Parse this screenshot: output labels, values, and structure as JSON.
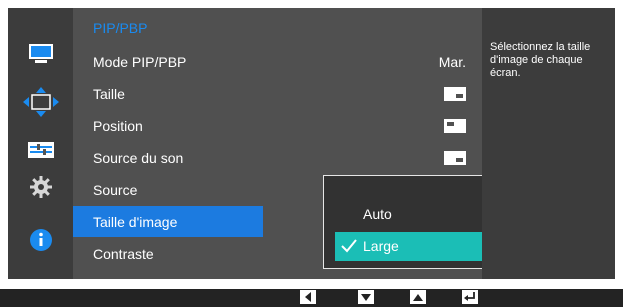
{
  "sidebar": {
    "icons": [
      "monitor-icon",
      "move-arrows-icon",
      "keyboard-settings-icon",
      "gear-icon",
      "info-icon"
    ]
  },
  "menu": {
    "title": "PIP/PBP",
    "items": [
      {
        "label": "Mode PIP/PBP",
        "value": "Mar."
      },
      {
        "label": "Taille",
        "value_icon": "pip-size-thumbnail"
      },
      {
        "label": "Position",
        "value_icon": "pip-position-thumbnail"
      },
      {
        "label": "Source du son",
        "value_icon": "sound-source-thumbnail"
      },
      {
        "label": "Source"
      },
      {
        "label": "Taille d'image"
      },
      {
        "label": "Contraste"
      }
    ]
  },
  "dropdown": {
    "options": [
      "Auto",
      "Large"
    ],
    "selected": "Large"
  },
  "help": {
    "text": "Sélectionnez la taille d'image de chaque écran."
  },
  "bottom_bar": {
    "buttons": [
      "left-arrow-icon",
      "down-arrow-icon",
      "up-arrow-icon",
      "enter-icon"
    ]
  },
  "colors": {
    "accent": "#1c7be0",
    "title": "#1a8bf0",
    "selection_teal": "#1bbeb6",
    "panel": "#505050",
    "frame": "#3c3c3c"
  }
}
